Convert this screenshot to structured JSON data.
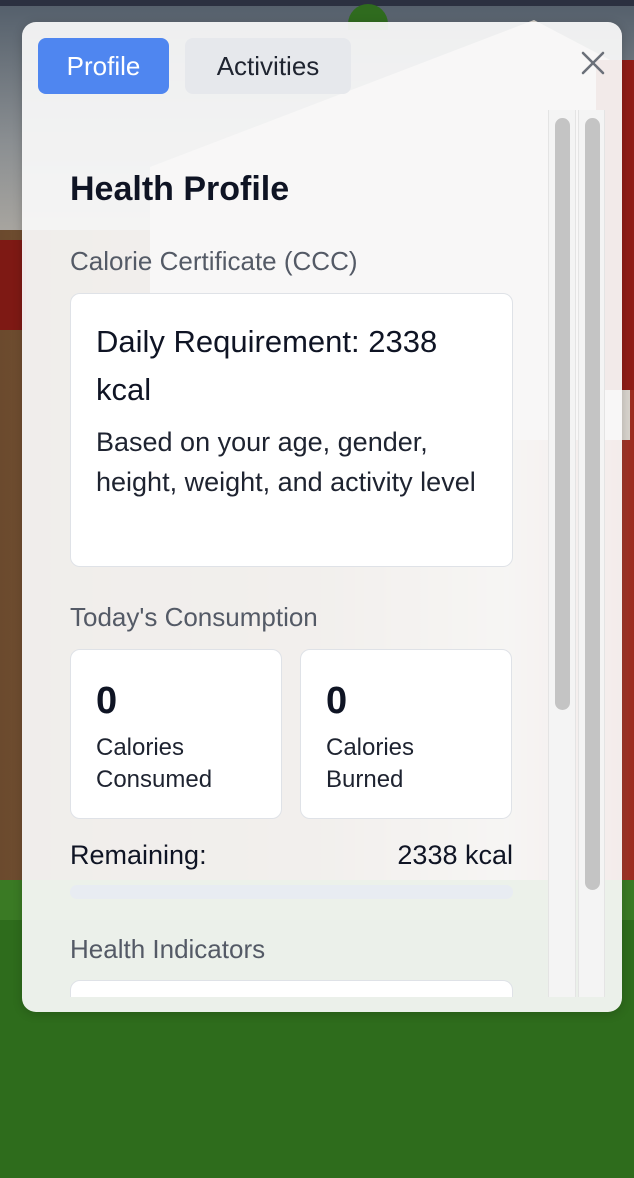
{
  "tabs": {
    "profile_label": "Profile",
    "activities_label": "Activities",
    "active": "Profile"
  },
  "profile": {
    "title": "Health Profile",
    "calorie_certificate": {
      "section_label": "Calorie Certificate (CCC)",
      "heading": "Daily Requirement: 2338 kcal",
      "description": "Based on your age, gender, height, weight, and activity level"
    },
    "today": {
      "section_label": "Today's Consumption",
      "consumed_value": "0",
      "consumed_label": "Calories Consumed",
      "burned_value": "0",
      "burned_label": "Calories Burned",
      "remaining_label": "Remaining:",
      "remaining_value": "2338 kcal",
      "progress_fraction": 0
    },
    "health_indicators": {
      "section_label": "Health Indicators"
    }
  },
  "icons": {
    "close": "close-icon"
  },
  "colors": {
    "accent": "#4f86f0",
    "tab_inactive": "#e6e8ec",
    "panel_bg": "#fafafa"
  }
}
